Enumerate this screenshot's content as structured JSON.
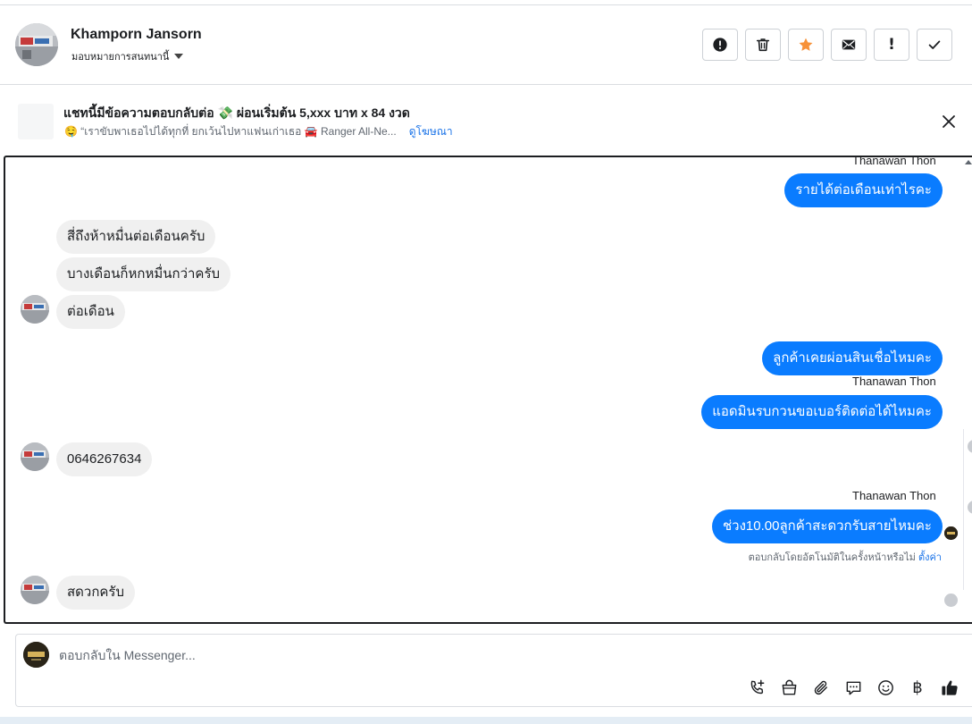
{
  "header": {
    "contact_name": "Khamporn Jansorn",
    "assign_label": "มอบหมายการสนทนานี้",
    "actions": [
      {
        "name": "report-button",
        "icon": "alert-circle-icon"
      },
      {
        "name": "delete-button",
        "icon": "trash-icon"
      },
      {
        "name": "star-button",
        "icon": "star-icon"
      },
      {
        "name": "mark-unread-button",
        "icon": "mail-icon"
      },
      {
        "name": "follow-up-button",
        "icon": "exclamation-icon",
        "glyph": "!"
      },
      {
        "name": "mark-done-button",
        "icon": "check-icon"
      }
    ],
    "star_color": "#f7923a"
  },
  "ad_banner": {
    "title": "แชทนี้มีข้อความตอบกลับต่อ 💸 ผ่อนเริ่มต้น 5,xxx บาท x 84 งวด",
    "snippet": "🤤 “เราขับพาเธอไปได้ทุกที่ ยกเว้นไปหาแฟนเก่าเธอ 🚘 Ranger All-Ne...",
    "link_label": "ดูโฆษณา"
  },
  "thread": {
    "accent_color": "#0a7cff",
    "messages": [
      {
        "direction": "out",
        "sender": "Thanawan Thon",
        "text": "รายได้ต่อเดือนเท่าไรคะ"
      },
      {
        "direction": "in",
        "text": "สี่ถึงห้าหมื่นต่อเดือนครับ"
      },
      {
        "direction": "in",
        "text": "บางเดือนก็หกหมื่นกว่าครับ"
      },
      {
        "direction": "in",
        "text": "ต่อเดือน"
      },
      {
        "direction": "out",
        "text": "ลูกค้าเคยผ่อนสินเชื่อไหมคะ"
      },
      {
        "direction": "out",
        "sender": "Thanawan Thon",
        "text": "แอดมินรบกวนขอเบอร์ติดต่อได้ไหมคะ"
      },
      {
        "direction": "in",
        "text": "0646267634"
      },
      {
        "direction": "out",
        "sender": "Thanawan Thon",
        "text": "ช่วง10.00ลูกค้าสะดวกรับสายไหมคะ"
      },
      {
        "direction": "in",
        "text": "สดวกครับ"
      }
    ],
    "auto_reply_note": "ตอบกลับโดยอัตโนมัติในครั้งหน้าหรือไม่",
    "auto_reply_link": "ตั้งค่า"
  },
  "composer": {
    "placeholder": "ตอบกลับใน Messenger...",
    "tools": [
      "call-icon",
      "shopping-bag-icon",
      "paperclip-icon",
      "saved-reply-icon",
      "emoji-icon",
      "baht-icon",
      "thumbs-up-icon"
    ],
    "baht_glyph": "฿"
  }
}
